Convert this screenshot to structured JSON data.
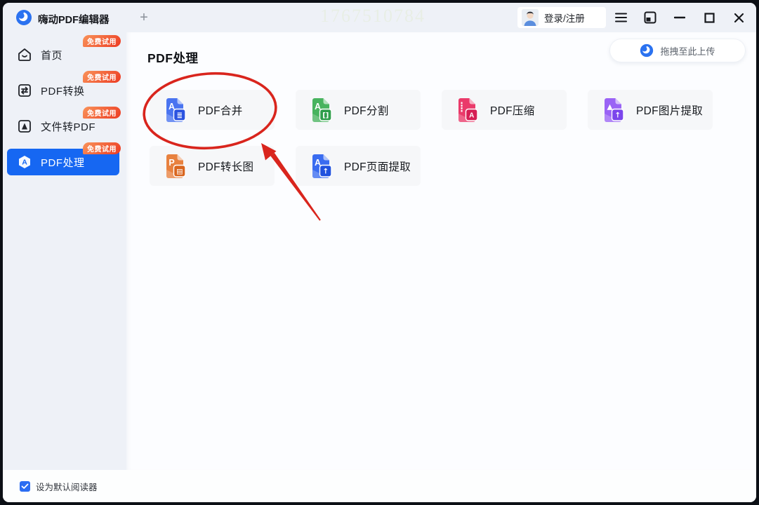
{
  "titlebar": {
    "app_title": "嗨动PDF编辑器",
    "new_tab_label": "+",
    "watermark": "1767510784",
    "login_label": "登录/注册"
  },
  "sidebar": {
    "badge_label": "免费试用",
    "items": [
      {
        "label": "首页",
        "icon": "home-icon",
        "active": false
      },
      {
        "label": "PDF转换",
        "icon": "pdf-convert-icon",
        "active": false
      },
      {
        "label": "文件转PDF",
        "icon": "file-to-pdf-icon",
        "active": false
      },
      {
        "label": "PDF处理",
        "icon": "pdf-process-icon",
        "active": true
      }
    ],
    "footer": {
      "label": "设为默认阅读器",
      "checkbox_checked": true
    }
  },
  "main": {
    "title": "PDF处理",
    "upload_label": "拖拽至此上传",
    "cards": [
      {
        "label": "PDF合并",
        "glyph_main": "A",
        "glyph_badge": "≣",
        "accent": "#4a74f0",
        "accent_dark": "#2b53e0"
      },
      {
        "label": "PDF分割",
        "glyph_main": "A",
        "glyph_badge": "[]",
        "accent": "#48b35e",
        "accent_dark": "#2f9e4b"
      },
      {
        "label": "PDF压缩",
        "glyph_main": "┋",
        "glyph_badge": "A",
        "accent": "#ea3a6a",
        "accent_dark": "#d61f55"
      },
      {
        "label": "PDF图片提取",
        "glyph_main": "▲",
        "glyph_badge": "↑",
        "accent": "#9a63f5",
        "accent_dark": "#7c46ec"
      },
      {
        "label": "PDF转长图",
        "glyph_main": "P",
        "glyph_badge": "▤",
        "accent": "#e8813f",
        "accent_dark": "#d9661f"
      },
      {
        "label": "PDF页面提取",
        "glyph_main": "A",
        "glyph_badge": "↑",
        "accent": "#3a6cf0",
        "accent_dark": "#2152de"
      }
    ],
    "annotation": {
      "shape": "ellipse-and-arrow",
      "target": "PDF合并",
      "color": "#d9251d"
    }
  }
}
